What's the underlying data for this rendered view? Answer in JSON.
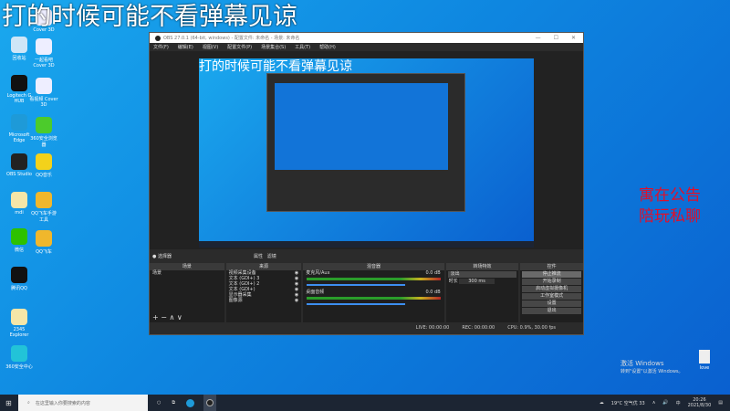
{
  "overlay_text": "打的时候可能不看弹幕见谅",
  "red_text": [
    "寓在公告",
    "陪玩私聊"
  ],
  "desktop_icons": [
    {
      "label": "回收站",
      "color": "#cfe6f7"
    },
    {
      "label": "Logitech G HUB",
      "color": "#111"
    },
    {
      "label": "Microsoft Edge",
      "color": "#1e9ad8"
    },
    {
      "label": "OBS Studio",
      "color": "#222"
    },
    {
      "label": "mdi",
      "color": "#f5e6a8"
    },
    {
      "label": "微信",
      "color": "#2dc100"
    },
    {
      "label": "腾讯QQ",
      "color": "#111"
    },
    {
      "label": "2345 Explorer",
      "color": "#f5e6a8"
    },
    {
      "label": "360安全中心",
      "color": "#22c3d8"
    },
    {
      "label": "Cover 3D",
      "color": "#eef"
    },
    {
      "label": "一起看吧 Cover 3D",
      "color": "#eef"
    },
    {
      "label": "看视频 Cover 3D",
      "color": "#eef"
    },
    {
      "label": "360安全浏览器",
      "color": "#4ccb2c"
    },
    {
      "label": "QQ音乐",
      "color": "#f3d21b"
    },
    {
      "label": "QQ飞车手游工具",
      "color": "#f0b72c"
    },
    {
      "label": "QQ飞车",
      "color": "#f0b72c"
    }
  ],
  "obs": {
    "title": "OBS 27.0.1 (64-bit, windows) - 配置文件: 未命名 - 场景: 未命名",
    "window_controls": [
      "—",
      "☐",
      "✕"
    ],
    "menu": [
      "文件(F)",
      "编辑(E)",
      "视图(V)",
      "配置文件(P)",
      "场景集合(S)",
      "工具(T)",
      "帮助(H)"
    ],
    "current_scene_label": "● 选择器",
    "props_btn": "属性",
    "filters_btn": "滤镜",
    "docks": {
      "scenes": "场景",
      "sources": "来源",
      "mixer": "混音器",
      "transitions": "转场特效",
      "controls": "控件"
    },
    "scenes": [
      "场景"
    ],
    "sources": [
      "视频采集设备",
      "文本 (GDI+) 3",
      "文本 (GDI+) 2",
      "文本 (GDI+)",
      "显示器采集",
      "图像源"
    ],
    "mixer": [
      {
        "name": "麦克风/Aux",
        "db": "0.0 dB"
      },
      {
        "name": "桌面音频",
        "db": "0.0 dB"
      }
    ],
    "transition": "淡出",
    "duration_label": "时长",
    "duration": "300 ms",
    "controls": [
      "停止推流",
      "开始录制",
      "启动虚拟摄像机",
      "工作室模式",
      "设置",
      "退出"
    ],
    "status": {
      "live": "LIVE: 00:00:00",
      "rec": "REC: 00:00:00",
      "cpu": "CPU: 0.9%, 30.00 fps"
    }
  },
  "activation": {
    "title": "激活 Windows",
    "sub": "转到\"设置\"以激活 Windows。"
  },
  "love_file": "love",
  "taskbar": {
    "search_placeholder": "在这里输入你要搜索的内容",
    "weather": "19°C 空气优 33",
    "time": "20:26",
    "date": "2021/8/30",
    "lang": "中"
  }
}
